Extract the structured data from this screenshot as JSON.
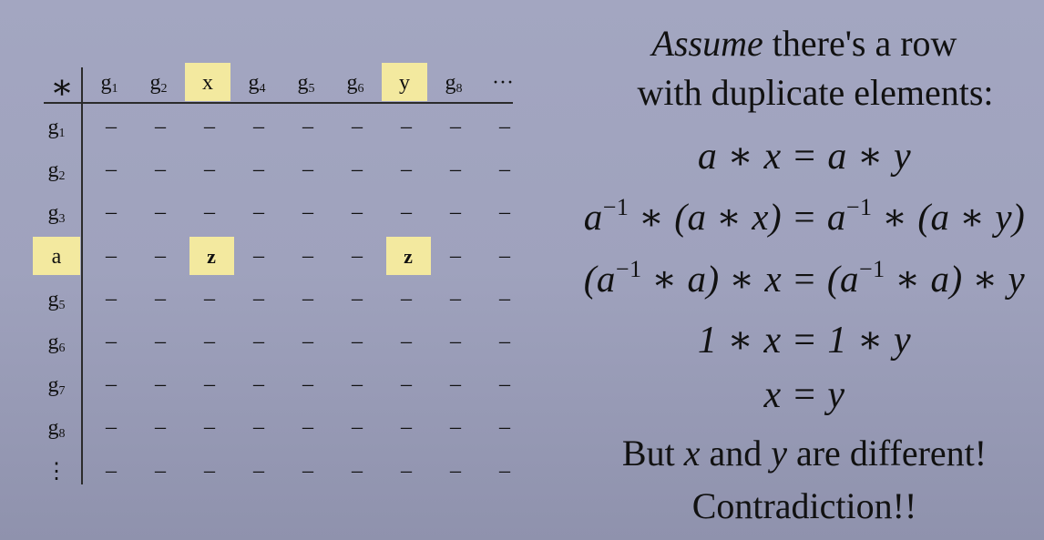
{
  "table": {
    "corner": "∗",
    "columns": [
      {
        "base": "g",
        "sub": "1",
        "highlight": false
      },
      {
        "base": "g",
        "sub": "2",
        "highlight": false
      },
      {
        "base": "x",
        "sub": "",
        "highlight": true
      },
      {
        "base": "g",
        "sub": "4",
        "highlight": false
      },
      {
        "base": "g",
        "sub": "5",
        "highlight": false
      },
      {
        "base": "g",
        "sub": "6",
        "highlight": false
      },
      {
        "base": "y",
        "sub": "",
        "highlight": true
      },
      {
        "base": "g",
        "sub": "8",
        "highlight": false
      },
      {
        "base": "···",
        "sub": "",
        "highlight": false
      }
    ],
    "rows": [
      {
        "base": "g",
        "sub": "1",
        "highlight": false,
        "cells": [
          "–",
          "–",
          "–",
          "–",
          "–",
          "–",
          "–",
          "–",
          "–"
        ]
      },
      {
        "base": "g",
        "sub": "2",
        "highlight": false,
        "cells": [
          "–",
          "–",
          "–",
          "–",
          "–",
          "–",
          "–",
          "–",
          "–"
        ]
      },
      {
        "base": "g",
        "sub": "3",
        "highlight": false,
        "cells": [
          "–",
          "–",
          "–",
          "–",
          "–",
          "–",
          "–",
          "–",
          "–"
        ]
      },
      {
        "base": "a",
        "sub": "",
        "highlight": true,
        "cells": [
          "–",
          "–",
          "z",
          "–",
          "–",
          "–",
          "z",
          "–",
          "–"
        ]
      },
      {
        "base": "g",
        "sub": "5",
        "highlight": false,
        "cells": [
          "–",
          "–",
          "–",
          "–",
          "–",
          "–",
          "–",
          "–",
          "–"
        ]
      },
      {
        "base": "g",
        "sub": "6",
        "highlight": false,
        "cells": [
          "–",
          "–",
          "–",
          "–",
          "–",
          "–",
          "–",
          "–",
          "–"
        ]
      },
      {
        "base": "g",
        "sub": "7",
        "highlight": false,
        "cells": [
          "–",
          "–",
          "–",
          "–",
          "–",
          "–",
          "–",
          "–",
          "–"
        ]
      },
      {
        "base": "g",
        "sub": "8",
        "highlight": false,
        "cells": [
          "–",
          "–",
          "–",
          "–",
          "–",
          "–",
          "–",
          "–",
          "–"
        ]
      },
      {
        "base": "⋮",
        "sub": "",
        "highlight": false,
        "cells": [
          "–",
          "–",
          "–",
          "–",
          "–",
          "–",
          "–",
          "–",
          "–"
        ]
      }
    ],
    "highlight_color": "#f3e99f"
  },
  "proof": {
    "assume_word": "Assume",
    "assume_rest": " there's a row",
    "line2": "with duplicate elements:",
    "eq1": "a ∗ x = a ∗ y",
    "eq2": {
      "a": "a",
      "inv": "−1",
      "mid": " ∗ (a ∗ x) = ",
      "a2": "a",
      "inv2": "−1",
      "end": " ∗ (a ∗ y)"
    },
    "eq3": {
      "open": "(a",
      "inv": "−1",
      "mid": " ∗ a) ∗ x = (a",
      "inv2": "−1",
      "end": " ∗ a) ∗ y"
    },
    "eq4": "1 ∗ x = 1 ∗ y",
    "eq5": "x = y",
    "but_prefix": "But ",
    "but_x": "x",
    "but_and": " and ",
    "but_y": "y",
    "but_rest": " are different!",
    "contradiction": "Contradiction!!"
  }
}
